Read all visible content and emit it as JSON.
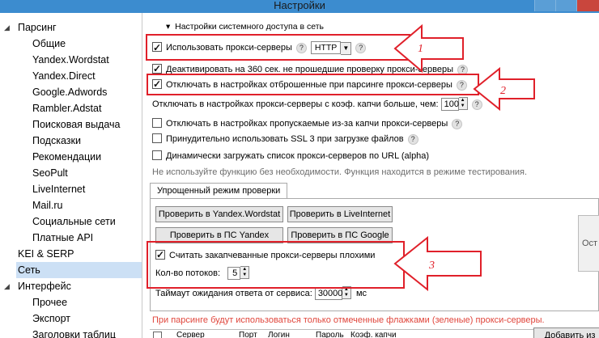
{
  "window": {
    "title": "Настройки"
  },
  "sidebar": {
    "items": [
      {
        "label": "Парсинг",
        "level": 0,
        "expander": "◢"
      },
      {
        "label": "Общие",
        "level": 1
      },
      {
        "label": "Yandex.Wordstat",
        "level": 1
      },
      {
        "label": "Yandex.Direct",
        "level": 1
      },
      {
        "label": "Google.Adwords",
        "level": 1
      },
      {
        "label": "Rambler.Adstat",
        "level": 1
      },
      {
        "label": "Поисковая выдача",
        "level": 1
      },
      {
        "label": "Подсказки",
        "level": 1
      },
      {
        "label": "Рекомендации",
        "level": 1
      },
      {
        "label": "SeoPult",
        "level": 1
      },
      {
        "label": "LiveInternet",
        "level": 1
      },
      {
        "label": "Mail.ru",
        "level": 1
      },
      {
        "label": "Социальные сети",
        "level": 1
      },
      {
        "label": "Платные API",
        "level": 1
      },
      {
        "label": "KEI & SERP",
        "level": 0
      },
      {
        "label": "Сеть",
        "level": 0,
        "selected": true
      },
      {
        "label": "Интерфейс",
        "level": 0,
        "expander": "◢"
      },
      {
        "label": "Прочее",
        "level": 1
      },
      {
        "label": "Экспорт",
        "level": 1
      },
      {
        "label": "Заголовки таблиц",
        "level": 1
      }
    ]
  },
  "main": {
    "section_title": "Настройки системного доступа в сеть",
    "section_arrow": "▾",
    "use_proxies": {
      "label": "Использовать прокси-серверы",
      "checked": true,
      "protocol": "HTTP"
    },
    "deactivate": {
      "label": "Деактивировать на 360 сек. не прошедшие проверку прокси-серверы",
      "checked": true
    },
    "disable_rejected": {
      "label": "Отключать в настройках отброшенные при парсинге прокси-серверы",
      "checked": true
    },
    "captcha_ratio": {
      "label": "Отключать в настройках прокси-серверы с коэф. капчи больше, чем:",
      "value": "100"
    },
    "disable_skipped": {
      "label": "Отключать в настройках пропускаемые из-за капчи прокси-серверы",
      "checked": false
    },
    "force_ssl": {
      "label": "Принудительно использовать SSL 3 при загрузке файлов",
      "checked": false
    },
    "dynamic_load": {
      "label": "Динамически загружать список прокси-серверов по URL (alpha)",
      "checked": false
    },
    "warning": "Не используйте функцию без необходимости. Функция находится в режиме тестирования.",
    "help_glyph": "?",
    "tab_label": "Упрощенный режим проверки",
    "buttons": {
      "check_wordstat": "Проверить в Yandex.Wordstat",
      "check_liveinternet": "Проверить в LiveInternet",
      "check_yandex": "Проверить в ПС Yandex",
      "check_google": "Проверить в ПС Google"
    },
    "bad_proxies": {
      "label": "Считать закапчеванные прокси-серверы плохими",
      "checked": true
    },
    "threads": {
      "label": "Кол-во потоков:",
      "value": "5"
    },
    "timeout": {
      "label": "Таймаут ожидания ответа от сервиса:",
      "value": "30000",
      "unit": "мс"
    },
    "side_button_partial": "Ост",
    "notice": "При парсинге будут использоваться только отмеченные флажками (зеленые) прокси-серверы.",
    "table": {
      "columns": [
        "Сервер",
        "Порт",
        "Логин",
        "Пароль",
        "Коэф. капчи"
      ]
    },
    "add_button": "Добавить из"
  },
  "annotations": {
    "labels": [
      "1",
      "2",
      "3"
    ],
    "color": "#e0202a"
  }
}
